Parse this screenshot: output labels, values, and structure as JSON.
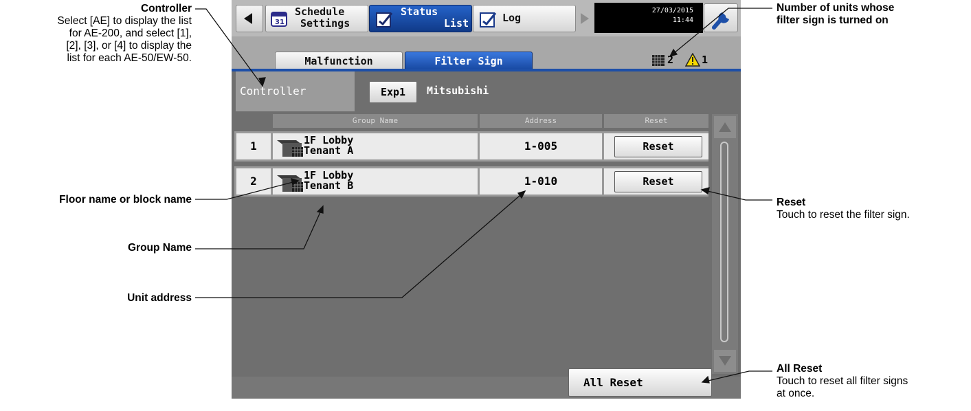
{
  "annotations": {
    "controller": {
      "title": "Controller",
      "description": "Select [AE] to display the list for AE-200, and select [1], [2], [3], or [4] to display the list for each AE-50/EW-50.",
      "lines": [
        "Select [AE] to display the list",
        "for AE-200, and select [1],",
        "[2], [3], or [4] to display the",
        "list for each AE-50/EW-50."
      ]
    },
    "floor_name": {
      "title": "Floor name or block name"
    },
    "group_name": {
      "title": "Group Name"
    },
    "unit_address": {
      "title": "Unit address"
    },
    "filter_count": {
      "title": "Number of units whose filter sign is turned on",
      "lines": [
        "Number of units whose",
        "filter sign is turned on"
      ]
    },
    "reset": {
      "title": "Reset",
      "description": "Touch to reset the filter sign."
    },
    "all_reset": {
      "title": "All Reset",
      "description": "Touch to reset all filter signs at once.",
      "lines": [
        "Touch to reset all filter signs",
        "at once."
      ]
    }
  },
  "top_tabs": [
    {
      "line1": "Schedule",
      "line2": "Settings",
      "icon": "calendar-icon",
      "active": false
    },
    {
      "line1": "Status",
      "line2": "List",
      "icon": "status-list-icon",
      "active": true
    },
    {
      "line1": "Log",
      "line2": "",
      "icon": "log-icon",
      "active": false
    }
  ],
  "datetime": {
    "date": "27/03/2015",
    "time": "11:44"
  },
  "sub_tabs": [
    {
      "label": "Malfunction",
      "active": false
    },
    {
      "label": "Filter Sign",
      "active": true
    }
  ],
  "counts": {
    "filter_sign": "2",
    "malfunction": "1"
  },
  "controller": {
    "label": "Controller",
    "selected": "Exp1",
    "name": "Mitsubishi"
  },
  "table": {
    "headers": {
      "group_name": "Group Name",
      "address": "Address",
      "reset": "Reset"
    },
    "rows": [
      {
        "num": "1",
        "floor": "1F Lobby",
        "group": "Tenant A",
        "address": "1-005",
        "reset_label": "Reset"
      },
      {
        "num": "2",
        "floor": "1F Lobby",
        "group": "Tenant B",
        "address": "1-010",
        "reset_label": "Reset"
      }
    ]
  },
  "all_reset_label": "All Reset",
  "colors": {
    "active_tab": "#1a4ca8",
    "screen_bg": "#6f6f6f",
    "warning": "#f5d800"
  }
}
